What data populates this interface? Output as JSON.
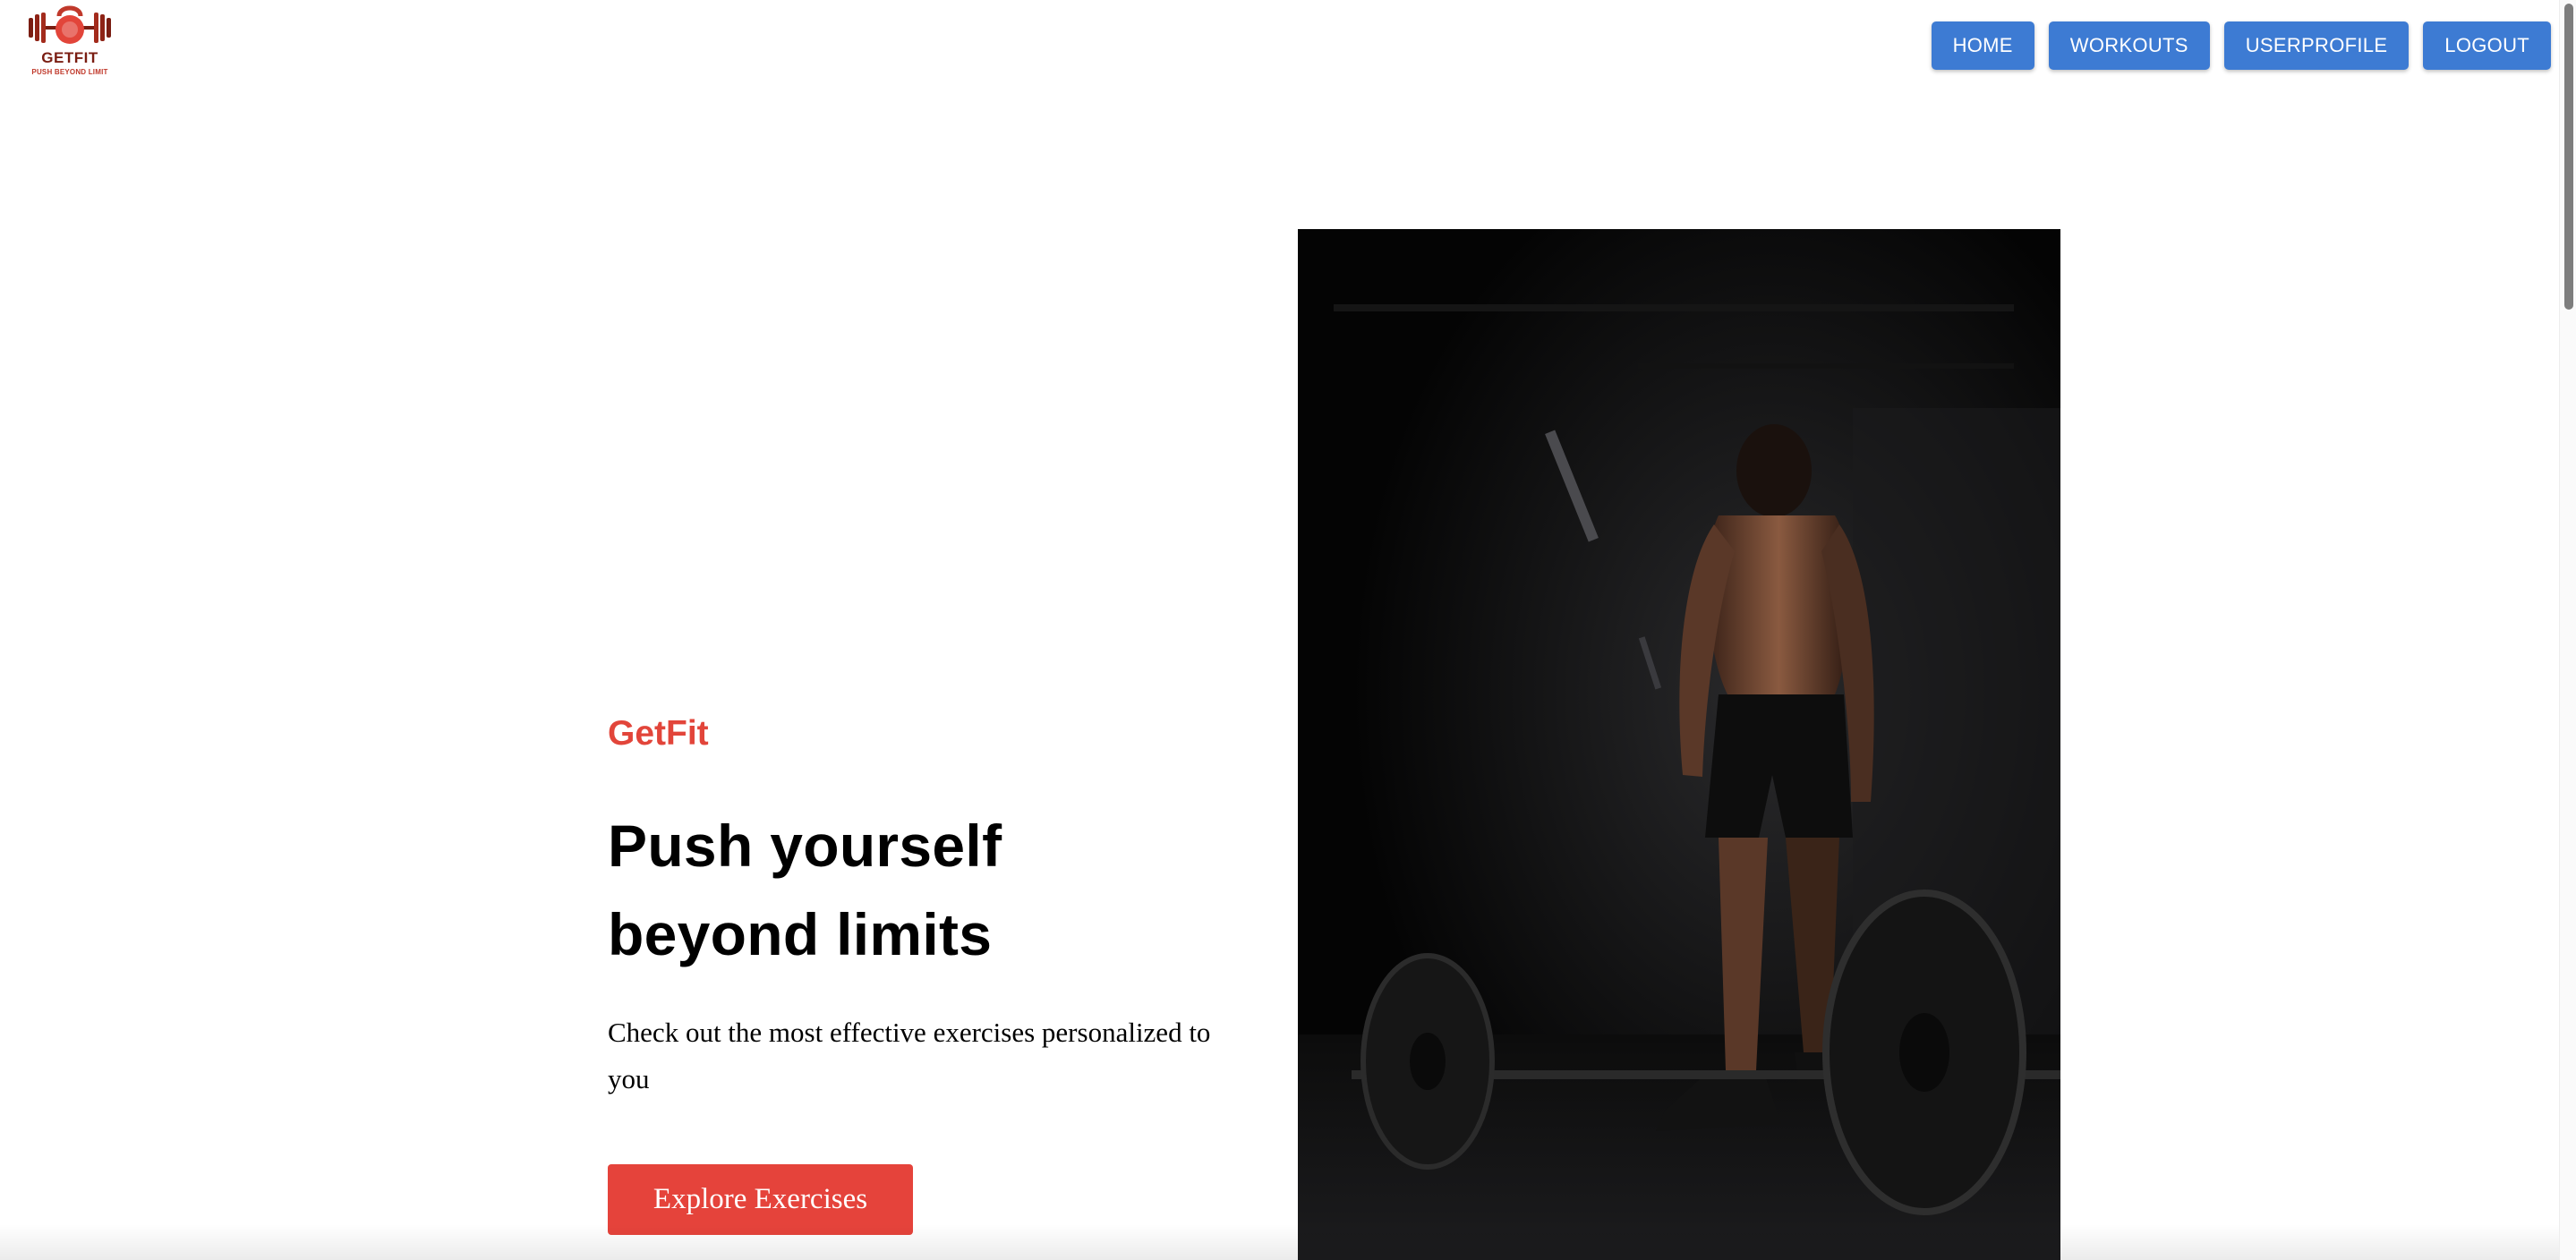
{
  "logo": {
    "icon": "kettlebell-dumbbell-icon",
    "brand": "GETFIT",
    "tagline": "PUSH BEYOND LIMIT"
  },
  "nav": {
    "items": [
      {
        "label": "HOME"
      },
      {
        "label": "WORKOUTS"
      },
      {
        "label": "USERPROFILE"
      },
      {
        "label": "LOGOUT"
      }
    ]
  },
  "hero": {
    "brand": "GetFit",
    "title": "Push yourself beyond limits",
    "subtitle": "Check out the most effective exercises personalized to you",
    "cta_label": "Explore Exercises",
    "image_alt": "athlete standing over a barbell in a dark gym"
  },
  "colors": {
    "accent": "#e5433b",
    "nav_button": "#3d7bd3",
    "logo_dark": "#7a1d12"
  }
}
